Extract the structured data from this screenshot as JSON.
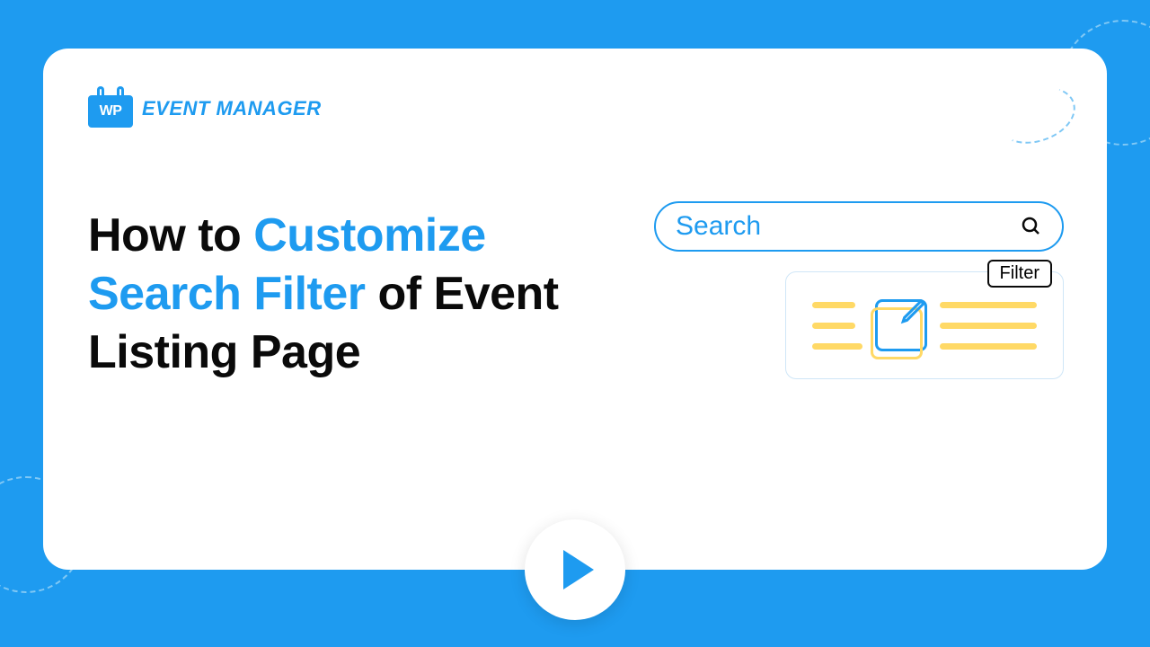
{
  "logo": {
    "icon_text": "WP",
    "brand_text": "EVENT MANAGER"
  },
  "headline": {
    "part1": "How to ",
    "highlight": "Customize Search Filter",
    "part2": " of Event Listing Page"
  },
  "search": {
    "placeholder": "Search"
  },
  "filter": {
    "label": "Filter"
  },
  "colors": {
    "brand": "#1e9bf0",
    "accent": "#ffd966"
  }
}
